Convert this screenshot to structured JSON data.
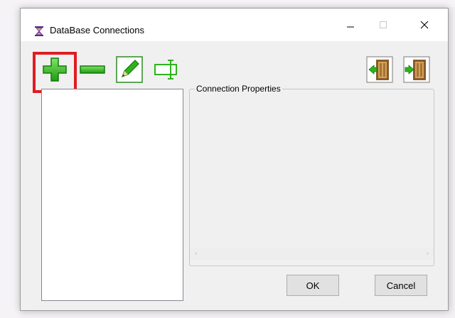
{
  "window": {
    "title": "DataBase Connections",
    "app_icon": "hourglass-app-icon"
  },
  "title_bar_controls": [
    "minimize-icon",
    "maximize-icon",
    "close-icon"
  ],
  "toolbar": {
    "left_buttons": [
      {
        "icon": "add-plus-icon",
        "color": "#2fb21c"
      },
      {
        "icon": "remove-minus-icon",
        "color": "#2fb21c"
      },
      {
        "icon": "edit-pencil-icon",
        "color": "#2fb21c"
      },
      {
        "icon": "rename-textbox-icon",
        "color": "#2fb21c"
      }
    ],
    "right_buttons": [
      {
        "icon": "import-door-icon"
      },
      {
        "icon": "export-door-icon"
      }
    ],
    "highlighted_button": "add-plus-icon",
    "highlight_color": "#e11b22"
  },
  "connections_list": {
    "items": []
  },
  "properties": {
    "legend": "Connection Properties"
  },
  "scrollbar": {
    "left_arrow": "‹",
    "right_arrow": "›"
  },
  "buttons": {
    "ok_label": "OK",
    "cancel_label": "Cancel"
  }
}
